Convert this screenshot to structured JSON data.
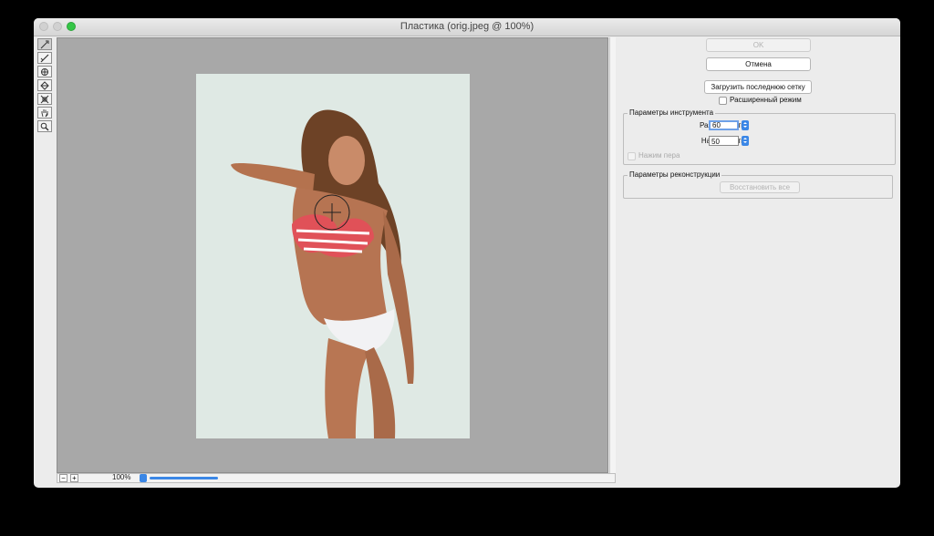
{
  "window": {
    "title": "Пластика (orig.jpeg @ 100%)"
  },
  "toolbar": {
    "tools": [
      {
        "name": "forward-warp-icon",
        "active": true
      },
      {
        "name": "reconstruct-icon",
        "active": false
      },
      {
        "name": "pucker-icon",
        "active": false
      },
      {
        "name": "bloat-icon",
        "active": false
      },
      {
        "name": "push-left-icon",
        "active": false
      },
      {
        "name": "hand-icon",
        "active": false
      },
      {
        "name": "zoom-icon",
        "active": false
      }
    ]
  },
  "statusbar": {
    "zoom_minus": "−",
    "zoom_plus": "+",
    "zoom_value": "100%"
  },
  "panel": {
    "ok_label": "OK",
    "cancel_label": "Отмена",
    "load_mesh_label": "Загрузить последнюю сетку",
    "advanced_mode_label": "Расширенный режим",
    "tool_options": {
      "title": "Параметры инструмента",
      "brush_size_label": "Размер кисти:",
      "brush_size_value": "60",
      "brush_pressure_label": "Нажим кисти:",
      "brush_pressure_value": "50",
      "stylus_pressure_label": "Нажим пера"
    },
    "reconstruct_options": {
      "title": "Параметры реконструкции",
      "restore_all_label": "Восстановить все"
    }
  }
}
